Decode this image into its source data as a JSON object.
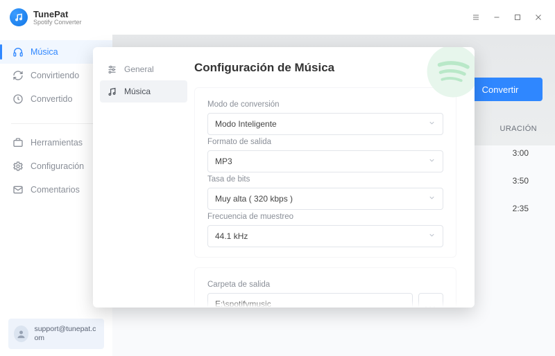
{
  "brand": {
    "name": "TunePat",
    "subtitle": "Spotify Converter"
  },
  "window_buttons": {
    "menu": "menu",
    "min": "minimize",
    "max": "maximize",
    "close": "close"
  },
  "sidebar": {
    "items": [
      {
        "icon": "headphones-icon",
        "label": "Música",
        "active": true
      },
      {
        "icon": "refresh-icon",
        "label": "Convirtiendo",
        "active": false
      },
      {
        "icon": "clock-icon",
        "label": "Convertido",
        "active": false
      }
    ],
    "tools": [
      {
        "icon": "briefcase-icon",
        "label": "Herramientas"
      },
      {
        "icon": "gear-icon",
        "label": "Configuración"
      },
      {
        "icon": "mail-icon",
        "label": "Comentarios"
      }
    ]
  },
  "support": {
    "email": "support@tunepat.com"
  },
  "content": {
    "convert_label": "Convertir",
    "duration_header": "URACIÓN",
    "durations": [
      "3:00",
      "3:50",
      "2:35"
    ]
  },
  "modal": {
    "tabs": [
      {
        "icon": "sliders-icon",
        "label": "General",
        "active": false
      },
      {
        "icon": "music-icon",
        "label": "Música",
        "active": true
      }
    ],
    "title": "Configuración de Música",
    "fields": {
      "conv_mode": {
        "label": "Modo de conversión",
        "value": "Modo Inteligente"
      },
      "out_format": {
        "label": "Formato de salida",
        "value": "MP3"
      },
      "bitrate": {
        "label": "Tasa de bits",
        "value": "Muy alta ( 320 kbps )"
      },
      "samplerate": {
        "label": "Frecuencia de muestreo",
        "value": "44.1 kHz"
      },
      "out_folder": {
        "label": "Carpeta de salida",
        "value": "E:\\spotifymusic"
      }
    },
    "browse_button": "..."
  },
  "colors": {
    "accent": "#2f87ff"
  }
}
